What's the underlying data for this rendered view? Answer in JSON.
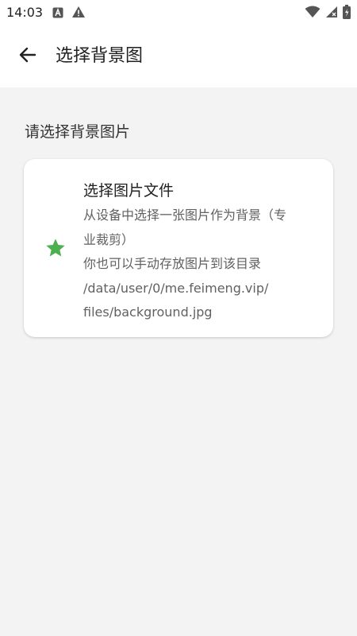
{
  "status_bar": {
    "time": "14:03",
    "left_icons": [
      "notification-a-icon",
      "warning-icon"
    ],
    "right_icons": [
      "wifi-icon",
      "signal-icon",
      "battery-icon"
    ]
  },
  "app_bar": {
    "title": "选择背景图",
    "back_icon": "back-arrow-icon"
  },
  "content": {
    "section_title": "请选择背景图片",
    "card": {
      "icon": "star-icon",
      "icon_color": "#4caf50",
      "title": "选择图片文件",
      "description_lines": [
        "从设备中选择一张图片作为背景（专",
        "业裁剪）",
        "你也可以手动存放图片到该目录",
        "/data/user/0/me.feimeng.vip/",
        "files/background.jpg"
      ]
    }
  }
}
